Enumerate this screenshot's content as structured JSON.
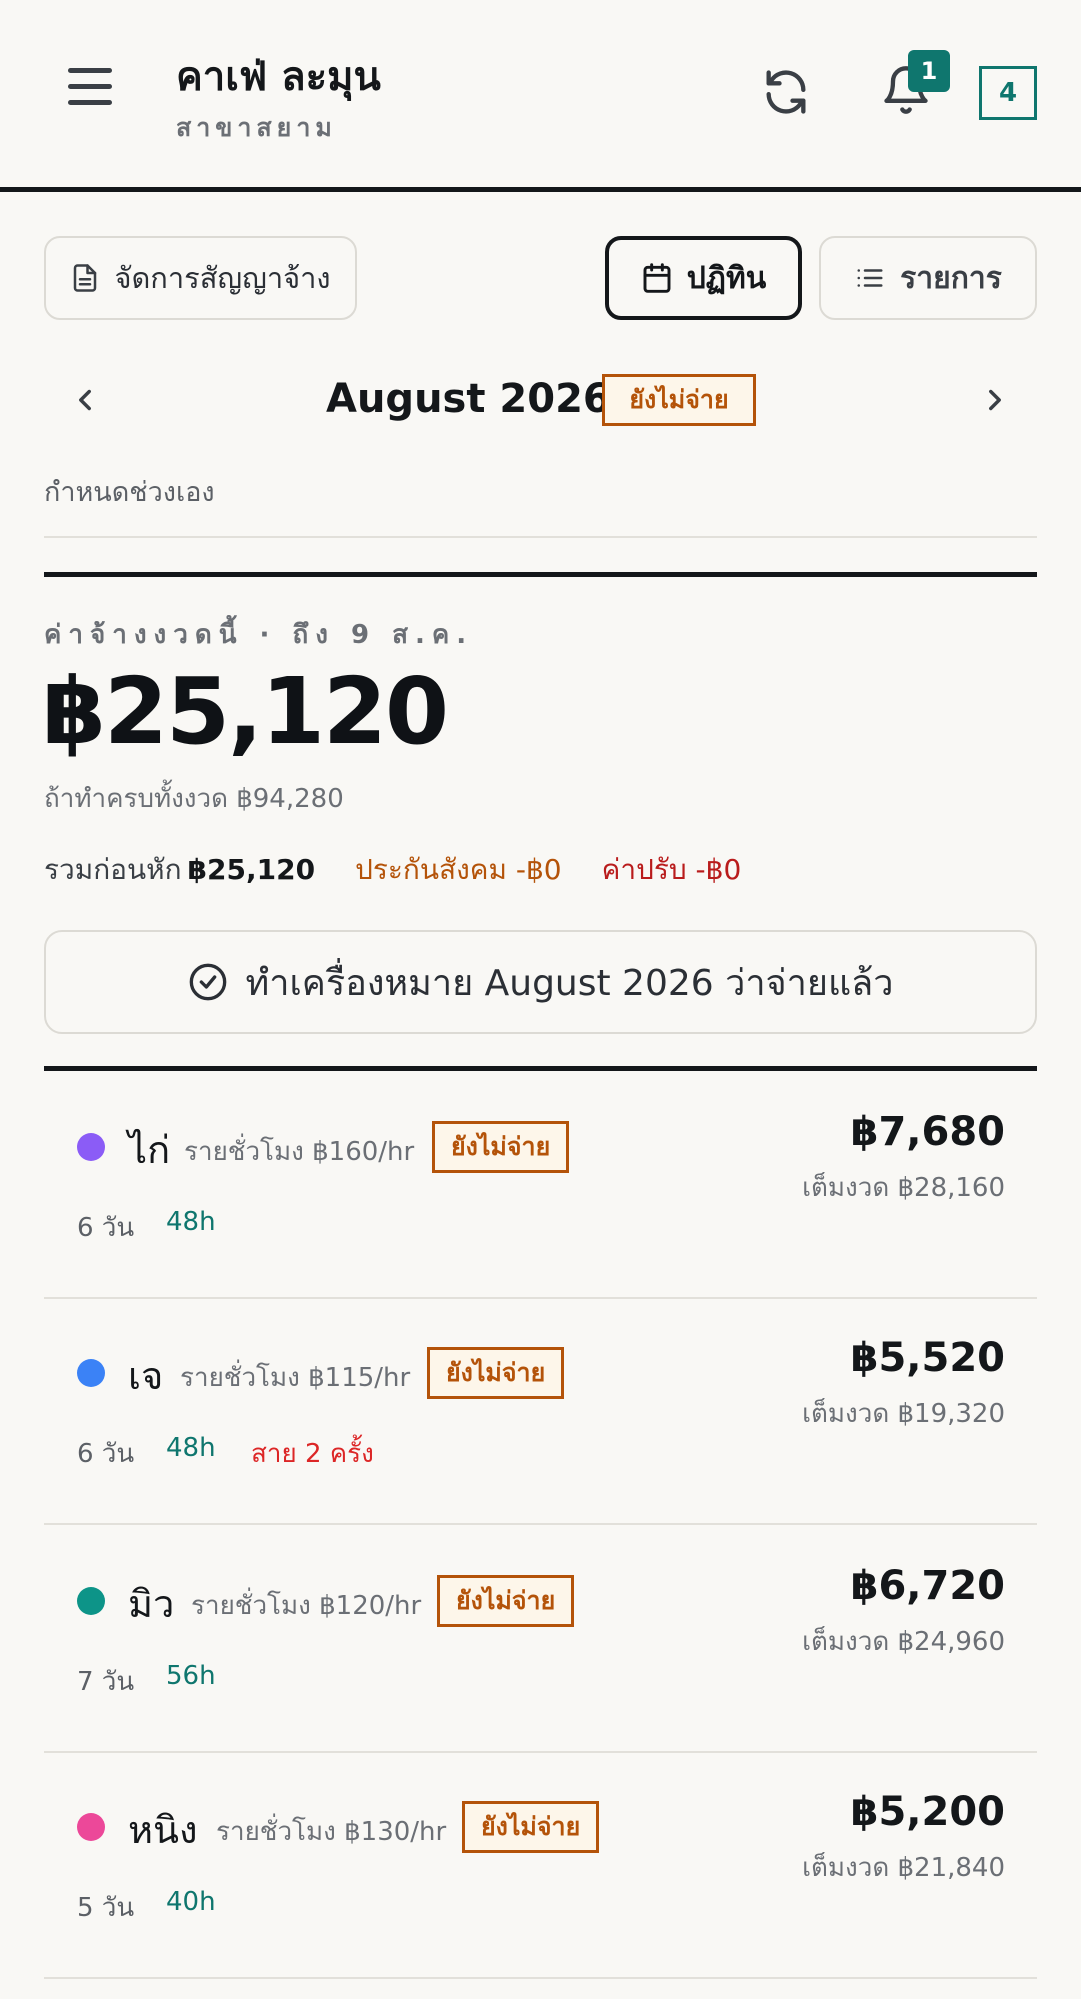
{
  "header": {
    "title": "คาเฟ่ ละมุน",
    "branch": "สาขาสยาม",
    "notification_count": "1",
    "box_count": "4"
  },
  "toolbar": {
    "contract_label": "จัดการสัญญาจ้าง",
    "calendar_label": "ปฏิทิน",
    "list_label": "รายการ"
  },
  "month_nav": {
    "label": "August 2026",
    "status": "ยังไม่จ่าย",
    "custom_range": "กำหนดช่วงเอง"
  },
  "summary": {
    "period_label": "ค่าจ้างงวดนี้ · ถึง 9 ส.ค.",
    "amount": "฿25,120",
    "full_period": "ถ้าทำครบทั้งงวด ฿94,280",
    "gross_label": "รวมก่อนหัก",
    "gross_value": "฿25,120",
    "social_security": "ประกันสังคม -฿0",
    "penalty": "ค่าปรับ -฿0",
    "mark_paid_label": "ทำเครื่องหมาย August 2026 ว่าจ่ายแล้ว"
  },
  "colors": {
    "accent": "#0f766e",
    "unpaid": "#b45309",
    "penalty": "#b91c1c",
    "late": "#dc2626"
  },
  "employees": [
    {
      "name": "ไก่",
      "rate": "รายชั่วโมง ฿160/hr",
      "status": "ยังไม่จ่าย",
      "amount": "฿7,680",
      "full": "เต็มงวด ฿28,160",
      "days": "6 วัน",
      "hours": "48h",
      "late": "",
      "color": "#8b5cf6"
    },
    {
      "name": "เจ",
      "rate": "รายชั่วโมง ฿115/hr",
      "status": "ยังไม่จ่าย",
      "amount": "฿5,520",
      "full": "เต็มงวด ฿19,320",
      "days": "6 วัน",
      "hours": "48h",
      "late": "สาย 2 ครั้ง",
      "color": "#3b82f6"
    },
    {
      "name": "มิว",
      "rate": "รายชั่วโมง ฿120/hr",
      "status": "ยังไม่จ่าย",
      "amount": "฿6,720",
      "full": "เต็มงวด ฿24,960",
      "days": "7 วัน",
      "hours": "56h",
      "late": "",
      "color": "#0d9488"
    },
    {
      "name": "หนิง",
      "rate": "รายชั่วโมง ฿130/hr",
      "status": "ยังไม่จ่าย",
      "amount": "฿5,200",
      "full": "เต็มงวด ฿21,840",
      "days": "5 วัน",
      "hours": "40h",
      "late": "",
      "color": "#ec4899"
    }
  ]
}
